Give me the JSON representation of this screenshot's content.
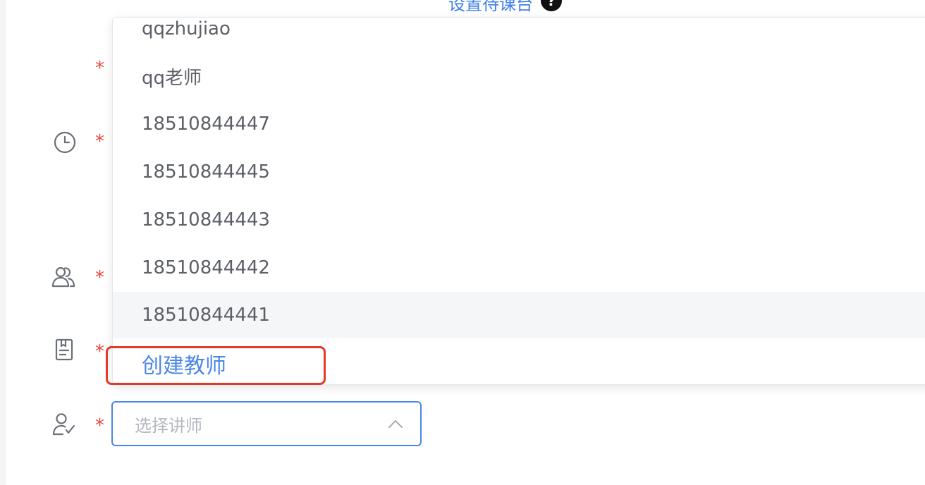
{
  "header": {
    "link_text": "设置待课台",
    "help_icon": "question-icon",
    "help_glyph": "?"
  },
  "form": {
    "required_mark": "*",
    "rows": [
      {
        "icon": "none"
      },
      {
        "icon": "clock-icon"
      },
      {
        "icon": "users-icon"
      },
      {
        "icon": "book-icon"
      },
      {
        "icon": "teacher-icon"
      }
    ]
  },
  "dropdown": {
    "options": [
      "qqzhujiao",
      "qq老师",
      "18510844447",
      "18510844445",
      "18510844443",
      "18510844442",
      "18510844441"
    ],
    "hovered_index": 6,
    "create_label": "创建教师"
  },
  "teacher_select": {
    "placeholder": "选择讲师",
    "arrow_icon": "chevron-up-icon"
  },
  "colors": {
    "accent": "#4a86e8",
    "required": "#e8483b",
    "highlight_box": "#e33a2a"
  }
}
